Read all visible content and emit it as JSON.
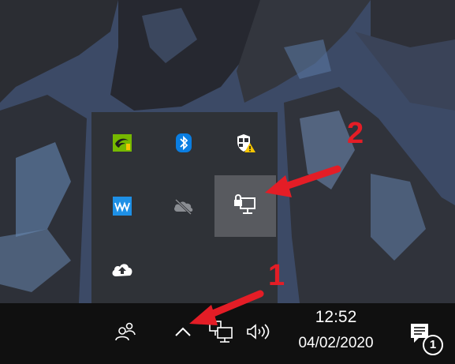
{
  "tray_flyout": {
    "icons": [
      "nvidia-icon",
      "bluetooth-icon",
      "windows-security-icon",
      "waves-maxxaudio-icon",
      "onedrive-icon",
      "network-lock-icon",
      "cloud-upload-icon"
    ]
  },
  "taskbar": {
    "icons": [
      "people-icon",
      "show-hidden-icons-chevron-icon",
      "network-icon",
      "volume-icon",
      "action-center-icon"
    ],
    "clock": {
      "time": "12:52",
      "date": "04/02/2020"
    },
    "notification_count": "1"
  },
  "annotations": {
    "step1": "1",
    "step2": "2",
    "arrow_color": "#e41d26"
  },
  "colors": {
    "nvidia_green": "#76b900",
    "bluetooth_blue": "#0a7ee2",
    "waves_blue": "#1e90e6",
    "warning_yellow": "#f5c400"
  }
}
